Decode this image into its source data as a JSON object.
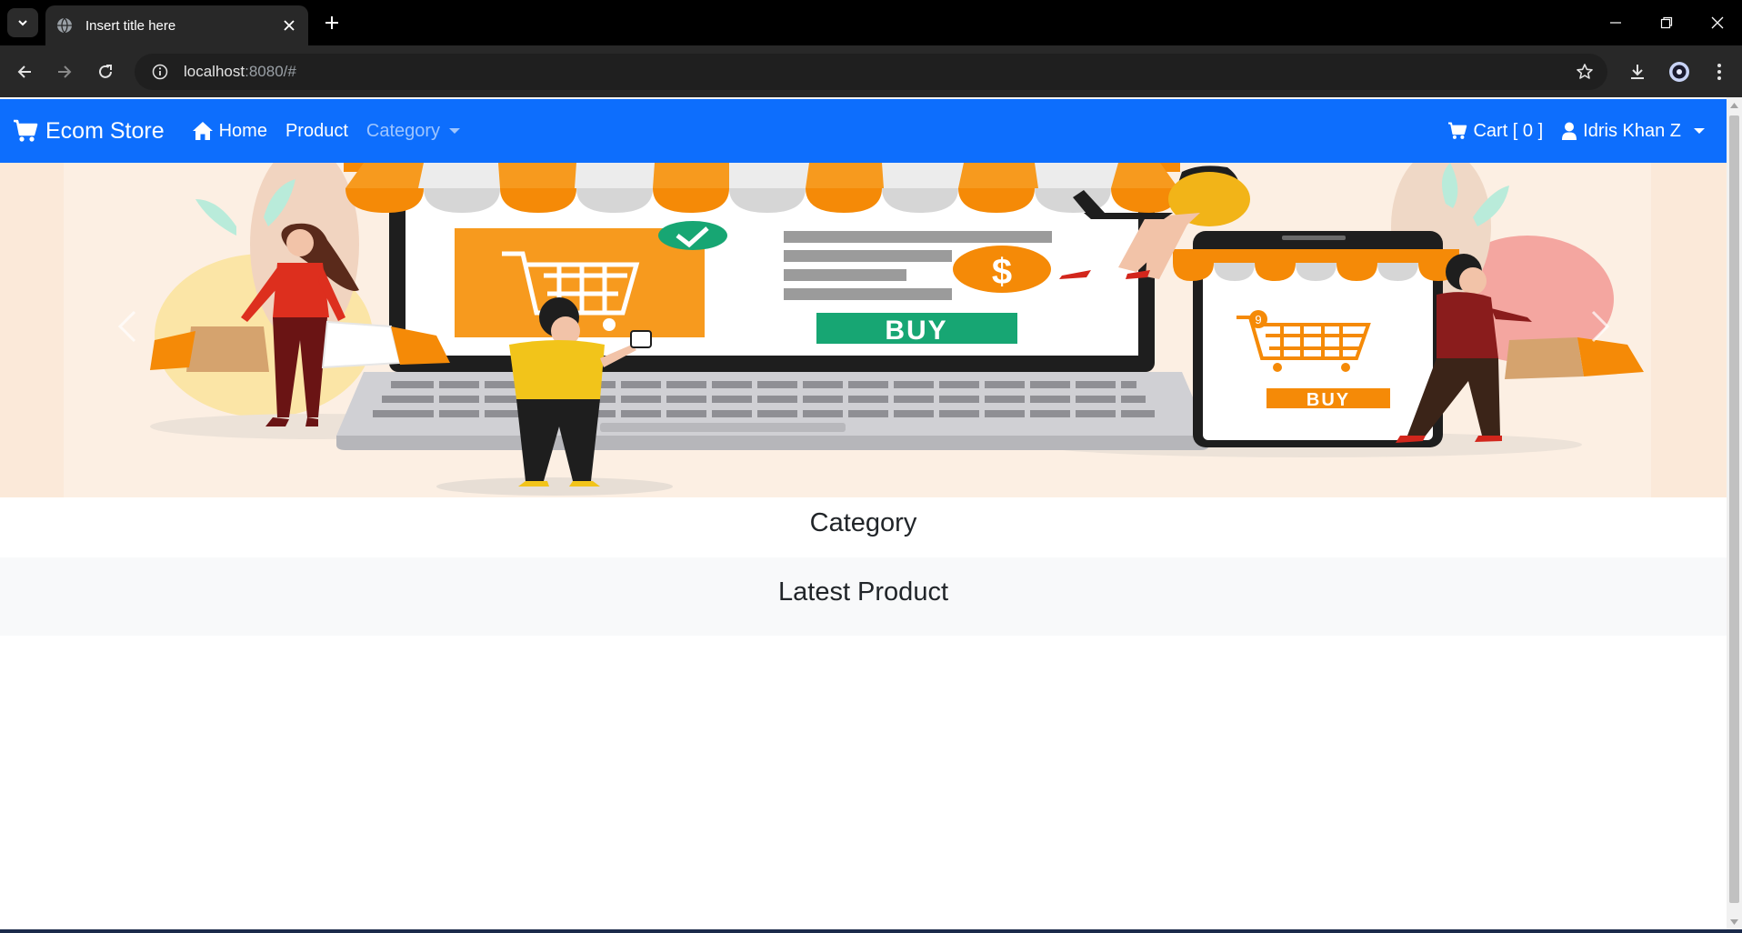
{
  "browser": {
    "tab_title": "Insert title here",
    "url_host": "localhost",
    "url_rest": ":8080/#"
  },
  "navbar": {
    "brand": "Ecom Store",
    "home": "Home",
    "product": "Product",
    "category": "Category",
    "cart": "Cart [ 0 ]",
    "user": "Idris Khan Z",
    "bg_color": "#0d6efd"
  },
  "banner": {
    "buy_laptop": "BUY",
    "buy_phone": "BUY",
    "cart_badge": "9",
    "dollar": "$"
  },
  "sections": {
    "category_title": "Category",
    "latest_title": "Latest Product"
  }
}
